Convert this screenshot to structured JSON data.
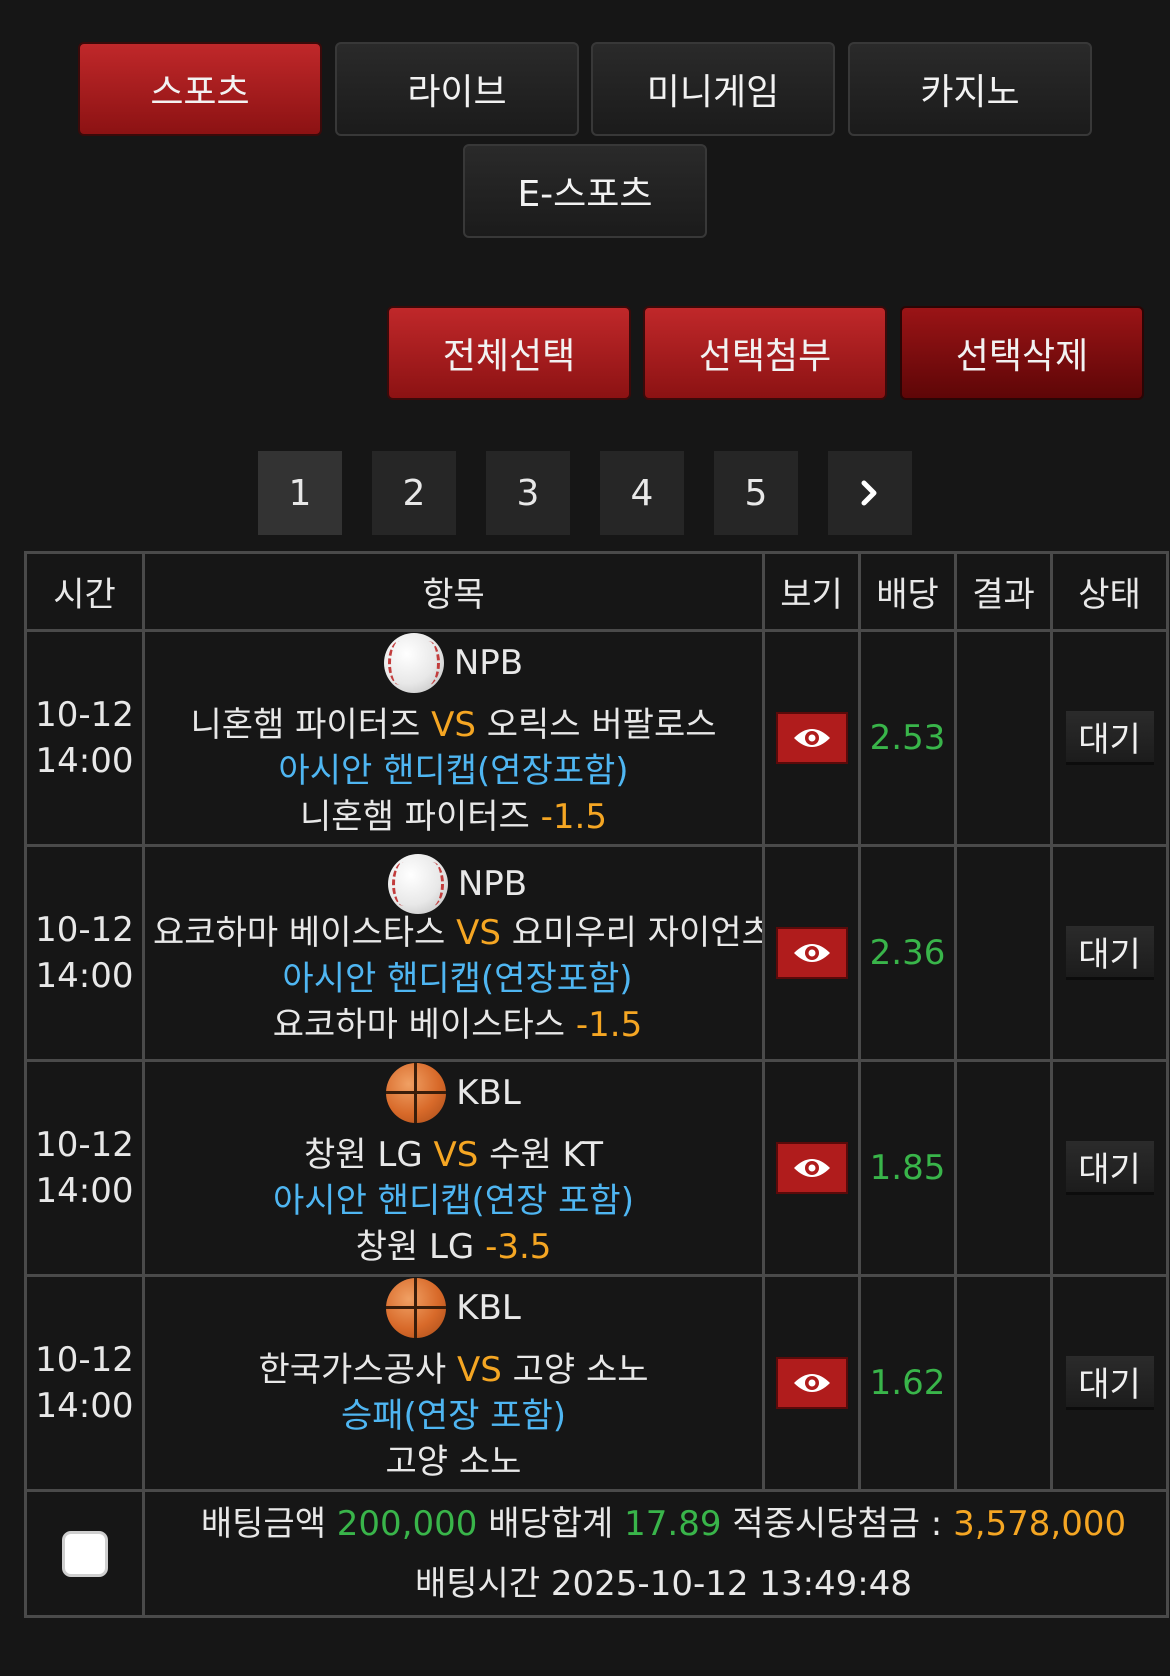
{
  "nav_tabs": [
    "스포츠",
    "라이브",
    "미니게임",
    "카지노",
    "E-스포츠"
  ],
  "actions": {
    "select_all": "전체선택",
    "attach_selected": "선택첨부",
    "delete_selected": "선택삭제"
  },
  "pagination": {
    "pages": [
      "1",
      "2",
      "3",
      "4",
      "5"
    ],
    "next_icon": "chevron-right-icon"
  },
  "table": {
    "headers": [
      "시간",
      "항목",
      "보기",
      "배당",
      "결과",
      "상태"
    ],
    "rows": [
      {
        "date": "10-12",
        "time": "14:00",
        "sport_icon": "baseball-icon",
        "league": "NPB",
        "home": "니혼햄 파이터즈",
        "vs": "VS",
        "away": "오릭스 버팔로스",
        "market": "아시안 핸디캡(연장포함)",
        "pick": "니혼햄 파이터즈",
        "handicap": "-1.5",
        "odds": "2.53",
        "result": "",
        "status": "대기"
      },
      {
        "date": "10-12",
        "time": "14:00",
        "sport_icon": "baseball-icon",
        "league": "NPB",
        "home": "요코하마 베이스타스",
        "vs": "VS",
        "away": "요미우리 자이언츠",
        "market": "아시안 핸디캡(연장포함)",
        "pick": "요코하마 베이스타스",
        "handicap": "-1.5",
        "odds": "2.36",
        "result": "",
        "status": "대기"
      },
      {
        "date": "10-12",
        "time": "14:00",
        "sport_icon": "basketball-icon",
        "league": "KBL",
        "home": "창원 LG",
        "vs": "VS",
        "away": "수원 KT",
        "market": "아시안 핸디캡(연장 포함)",
        "pick": "창원 LG",
        "handicap": "-3.5",
        "odds": "1.85",
        "result": "",
        "status": "대기"
      },
      {
        "date": "10-12",
        "time": "14:00",
        "sport_icon": "basketball-icon",
        "league": "KBL",
        "home": "한국가스공사",
        "vs": "VS",
        "away": "고양 소노",
        "market": "승패(연장 포함)",
        "pick": "고양 소노",
        "handicap": "",
        "odds": "1.62",
        "result": "",
        "status": "대기"
      }
    ]
  },
  "summary": {
    "bet_amount_label": "배팅금액",
    "bet_amount": "200,000",
    "total_odds_label": "배당합계",
    "total_odds": "17.89",
    "payout_label": "적중시당첨금 :",
    "payout": "3,578,000",
    "bet_time_label": "배팅시간",
    "bet_time": "2025-10-12 13:49:48"
  },
  "colors": {
    "accent_red": "#b01c1c",
    "vs_orange": "#f5a623",
    "market_blue": "#4fb6f2",
    "odds_green": "#39b54a"
  }
}
